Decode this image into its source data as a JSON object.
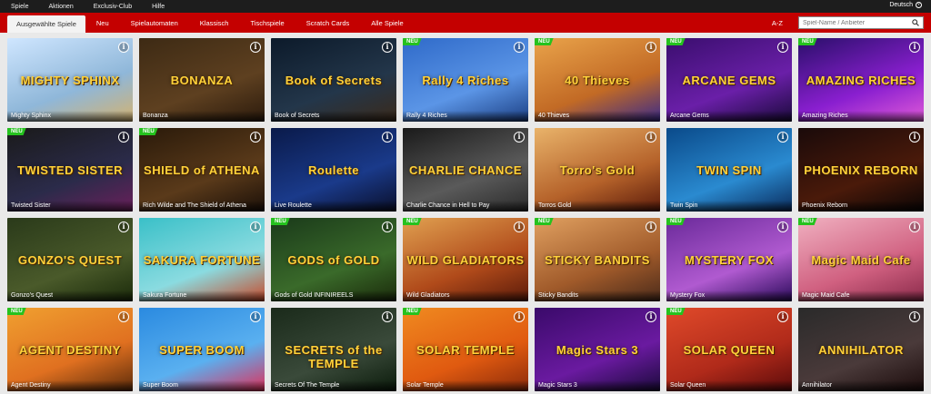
{
  "topbar": {
    "items": [
      "Spiele",
      "Aktionen",
      "Exclusiv-Club",
      "Hilfe"
    ],
    "language": "Deutsch"
  },
  "nav": {
    "tabs": [
      "Ausgewählte Spiele",
      "Neu",
      "Spielautomaten",
      "Klassisch",
      "Tischspiele",
      "Scratch Cards",
      "Alle Spiele"
    ],
    "az": "A-Z",
    "search_placeholder": "Spiel-Name / Anbieter"
  },
  "badge_label": "NEU",
  "info_label": "i",
  "games": [
    {
      "name": "Mighty Sphinx",
      "logo": "MIGHTY SPHINX",
      "neu": false,
      "bg": "linear-gradient(160deg,#cfe6ff,#8fb7d9 60%,#d3b270)"
    },
    {
      "name": "Bonanza",
      "logo": "BONANZA",
      "neu": false,
      "bg": "linear-gradient(160deg,#3d2a14,#5e4020 60%,#2b1a0c)"
    },
    {
      "name": "Book of Secrets",
      "logo": "Book of Secrets",
      "neu": false,
      "bg": "linear-gradient(160deg,#0c1a2a,#23364a 60%,#3b2a1a)"
    },
    {
      "name": "Rally 4 Riches",
      "logo": "Rally 4 Riches",
      "neu": true,
      "bg": "linear-gradient(160deg,#2f6ac9,#5b95e6 60%,#1c3f83)"
    },
    {
      "name": "40 Thieves",
      "logo": "40 Thieves",
      "neu": true,
      "bg": "linear-gradient(160deg,#e9a34a,#c26a25 60%,#3a2a8a)"
    },
    {
      "name": "Arcane Gems",
      "logo": "ARCANE GEMS",
      "neu": true,
      "bg": "linear-gradient(160deg,#3a0e6e,#6a1fa8 60%,#1a0a3a)"
    },
    {
      "name": "Amazing Riches",
      "logo": "AMAZING RICHES",
      "neu": true,
      "bg": "linear-gradient(160deg,#2a0f6a,#8a1fd0 60%,#e05ad8)"
    },
    {
      "name": "Twisted Sister",
      "logo": "TWISTED SISTER",
      "neu": true,
      "bg": "linear-gradient(160deg,#1a1a1a,#2b2b4a 60%,#6a1f5a)"
    },
    {
      "name": "Rich Wilde and The Shield of Athena",
      "logo": "SHIELD of ATHENA",
      "neu": true,
      "bg": "linear-gradient(160deg,#2a1a0a,#5a3a1a 60%,#1a0f08)"
    },
    {
      "name": "Live Roulette",
      "logo": "Roulette",
      "neu": false,
      "bg": "linear-gradient(160deg,#0a1a4a,#1a3a8a 60%,#0a0f2a)"
    },
    {
      "name": "Charlie Chance in Hell to Pay",
      "logo": "CHARLIE CHANCE",
      "neu": false,
      "bg": "linear-gradient(160deg,#1a1a1a,#5a5a5a 60%,#2a2a2a)"
    },
    {
      "name": "Torros Gold",
      "logo": "Torro's Gold",
      "neu": false,
      "bg": "linear-gradient(160deg,#e9b36a,#b5622a 60%,#5a1a0a)"
    },
    {
      "name": "Twin Spin",
      "logo": "TWIN SPIN",
      "neu": false,
      "bg": "linear-gradient(160deg,#0a4a8a,#2a8ad0 60%,#0a2a5a)"
    },
    {
      "name": "Phoenix Reborn",
      "logo": "PHOENIX REBORN",
      "neu": false,
      "bg": "linear-gradient(160deg,#1a0a0a,#4a1a0a 60%,#0a0505)"
    },
    {
      "name": "Gonzo's Quest",
      "logo": "GONZO'S QUEST",
      "neu": false,
      "bg": "linear-gradient(160deg,#2a3a1a,#4a5a2a 60%,#1a2a0a)"
    },
    {
      "name": "Sakura Fortune",
      "logo": "SAKURA FORTUNE",
      "neu": false,
      "bg": "linear-gradient(160deg,#3ac0c8,#8adbe0 60%,#c84a2a)"
    },
    {
      "name": "Gods of Gold INFINIREELS",
      "logo": "GODS of GOLD",
      "neu": true,
      "bg": "linear-gradient(160deg,#1a3a1a,#3a6a2a 60%,#1a2a0a)"
    },
    {
      "name": "Wild Gladiators",
      "logo": "WILD GLADIATORS",
      "neu": true,
      "bg": "linear-gradient(160deg,#e0a050,#b04a1a 60%,#5a1a0a)"
    },
    {
      "name": "Sticky Bandits",
      "logo": "STICKY BANDITS",
      "neu": true,
      "bg": "linear-gradient(160deg,#e0a060,#a05a2a 60%,#4a2a1a)"
    },
    {
      "name": "Mystery Fox",
      "logo": "MYSTERY FOX",
      "neu": true,
      "bg": "linear-gradient(160deg,#6a2a9a,#b05ad0 60%,#2a0a5a)"
    },
    {
      "name": "Magic Maid Cafe",
      "logo": "Magic Maid Cafe",
      "neu": true,
      "bg": "linear-gradient(160deg,#f0b0c0,#d06080 60%,#8a2a4a)"
    },
    {
      "name": "Agent Destiny",
      "logo": "AGENT DESTINY",
      "neu": true,
      "bg": "linear-gradient(160deg,#f0a030,#e07020 60%,#5a2a0a)"
    },
    {
      "name": "Super Boom",
      "logo": "SUPER BOOM",
      "neu": false,
      "bg": "linear-gradient(160deg,#2a8ae0,#5ab0f0 60%,#e0305a)"
    },
    {
      "name": "Secrets Of The Temple",
      "logo": "SECRETS of the TEMPLE",
      "neu": false,
      "bg": "linear-gradient(160deg,#1a2a1a,#3a4a3a 60%,#0a1a0a)"
    },
    {
      "name": "Solar Temple",
      "logo": "SOLAR TEMPLE",
      "neu": true,
      "bg": "linear-gradient(160deg,#f08a20,#e05a10 60%,#8a2a0a)"
    },
    {
      "name": "Magic Stars 3",
      "logo": "Magic Stars 3",
      "neu": false,
      "bg": "linear-gradient(160deg,#3a0a6a,#6a1aa0 60%,#1a0a3a)"
    },
    {
      "name": "Solar Queen",
      "logo": "SOLAR QUEEN",
      "neu": true,
      "bg": "linear-gradient(160deg,#e04a2a,#b02a1a 60%,#5a0a0a)"
    },
    {
      "name": "Annihilator",
      "logo": "ANNIHILATOR",
      "neu": false,
      "bg": "linear-gradient(160deg,#2a2a2a,#4a3a3a 60%,#1a0a0a)"
    }
  ]
}
